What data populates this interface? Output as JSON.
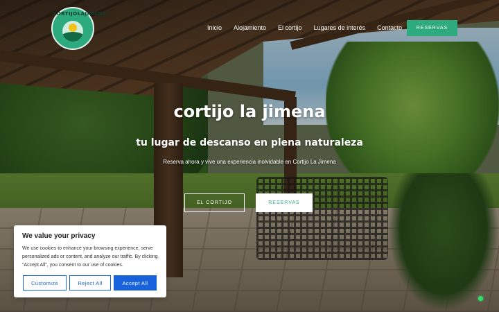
{
  "brand": {
    "logo_text": "CORTIJOLAJIMENA"
  },
  "nav": {
    "items": [
      "Inicio",
      "Alojamiento",
      "El cortijo",
      "Lugares de interés",
      "Contacto"
    ],
    "cta_label": "RESERVAS"
  },
  "hero": {
    "title": "cortijo la jimena",
    "subtitle": "tu lugar de descanso en plena naturaleza",
    "description": "Reserva ahora y vive una experiencia inolvidable en Cortijo La Jimena",
    "button_primary": "EL CORTIJO",
    "button_secondary": "RESERVAS"
  },
  "cookie": {
    "title": "We value your privacy",
    "text": "We use cookies to enhance your browsing experience, serve personalized ads or content, and analyze our traffic. By clicking \"Accept All\", you consent to our use of cookies.",
    "customize_label": "Customize",
    "reject_label": "Reject All",
    "accept_label": "Accept All"
  },
  "colors": {
    "brand_green": "#2eaa7f",
    "cookie_blue": "#1863dc",
    "status_dot": "#2ee06c"
  }
}
